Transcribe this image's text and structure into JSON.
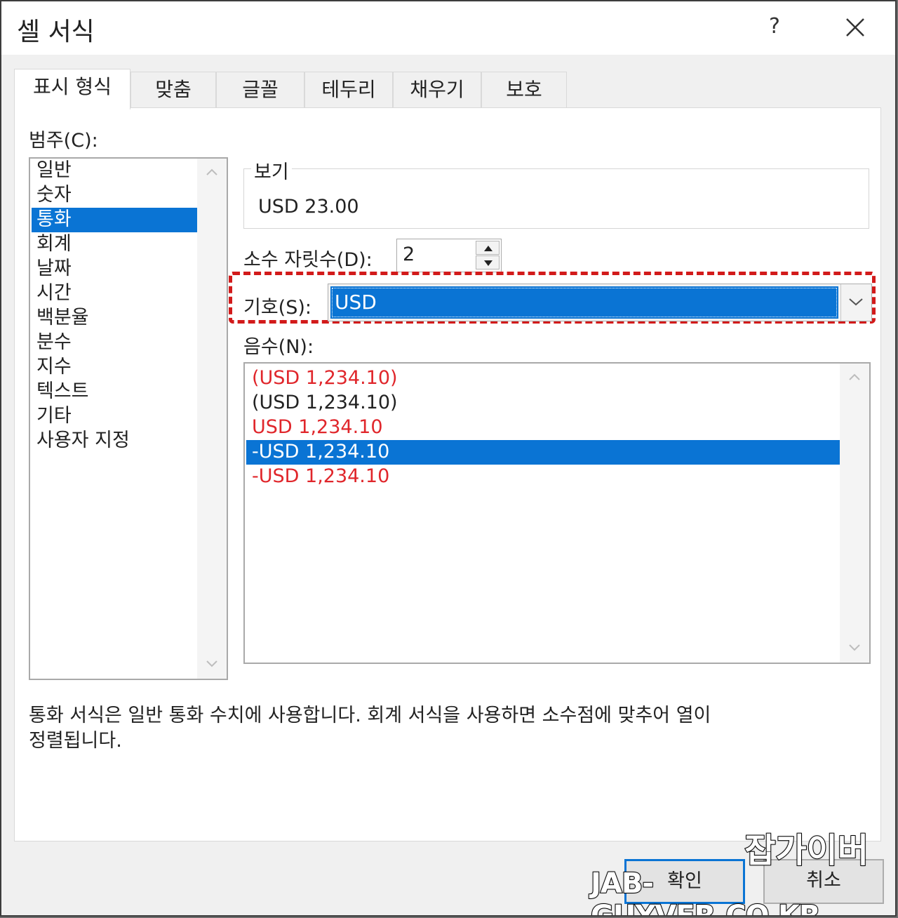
{
  "dialog": {
    "title": "셀 서식",
    "help": "?"
  },
  "tabs": [
    {
      "label": "표시 형식"
    },
    {
      "label": "맞춤"
    },
    {
      "label": "글꼴"
    },
    {
      "label": "테두리"
    },
    {
      "label": "채우기"
    },
    {
      "label": "보호"
    }
  ],
  "category": {
    "label": "범주(C):",
    "items": [
      {
        "label": "일반"
      },
      {
        "label": "숫자"
      },
      {
        "label": "통화"
      },
      {
        "label": "회계"
      },
      {
        "label": "날짜"
      },
      {
        "label": "시간"
      },
      {
        "label": "백분율"
      },
      {
        "label": "분수"
      },
      {
        "label": "지수"
      },
      {
        "label": "텍스트"
      },
      {
        "label": "기타"
      },
      {
        "label": "사용자 지정"
      }
    ],
    "selected": "통화"
  },
  "preview": {
    "legend": "보기",
    "value": "USD 23.00"
  },
  "decimal_places": {
    "label": "소수 자릿수(D):",
    "value": "2"
  },
  "symbol": {
    "label": "기호(S):",
    "value": "USD"
  },
  "negative_numbers": {
    "label": "음수(N):",
    "items": [
      {
        "label": "(USD 1,234.10)",
        "color": "#e0262b"
      },
      {
        "label": "(USD 1,234.10)",
        "color": "#222222"
      },
      {
        "label": "USD 1,234.10",
        "color": "#e0262b"
      },
      {
        "label": "-USD 1,234.10",
        "color": "#222222"
      },
      {
        "label": "-USD 1,234.10",
        "color": "#e0262b"
      }
    ],
    "selected_index": 3
  },
  "description": {
    "line1": "통화 서식은 일반 통화 수치에 사용합니다. 회계 서식을 사용하면 소수점에 맞추어 열이",
    "line2": "정렬됩니다."
  },
  "buttons": {
    "ok": "확인",
    "cancel": "취소"
  },
  "watermark": {
    "line1": "잡가이버",
    "line2": "JAB-GUYVER.CO.KR"
  },
  "colors": {
    "selection": "#0a74d4",
    "negative_red": "#e0262b",
    "highlight_dashed": "#d21a1a"
  }
}
